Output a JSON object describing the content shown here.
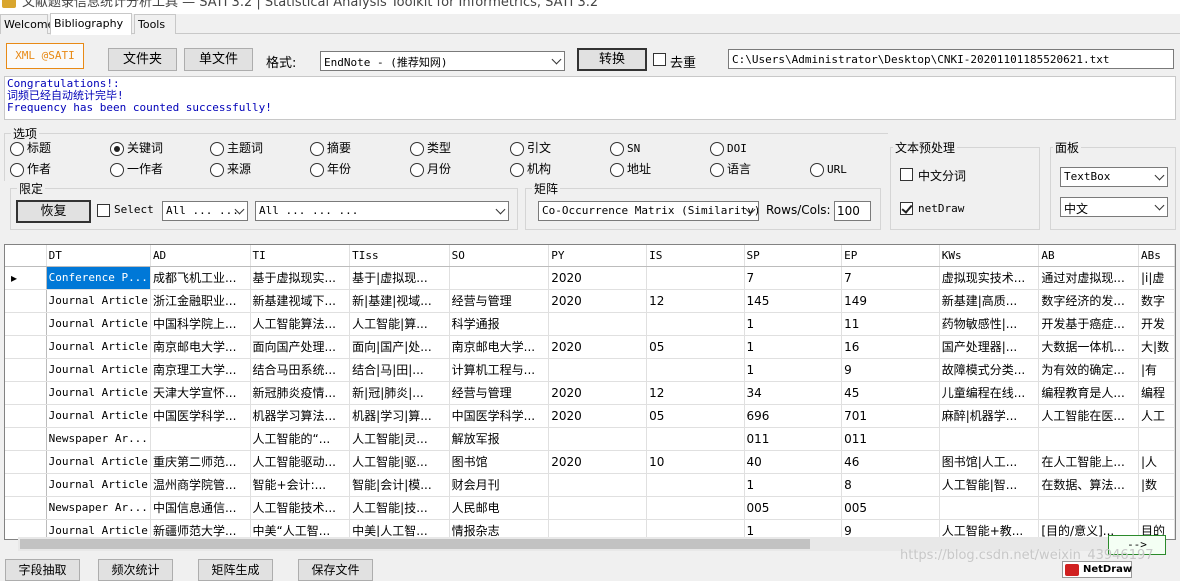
{
  "window": {
    "title": "文献题录信息统计分析工具 — SATI 3.2 | Statistical Analysis Toolkit for Informetrics, SATI 3.2"
  },
  "tabs": [
    "Welcome",
    "Bibliography",
    "Tools"
  ],
  "toolbar": {
    "xml_label": "XML @SATI",
    "folder_button": "文件夹",
    "file_button": "单文件",
    "format_label": "格式:",
    "format_value": "EndNote  - (推荐知网)",
    "convert_button": "转换",
    "dedupe_label": "去重",
    "path_value": "C:\\Users\\Administrator\\Desktop\\CNKI-20201101185520621.txt"
  },
  "messages": [
    "Congratulations!:",
    "词频已经自动统计完毕!",
    "Frequency has been counted successfully!"
  ],
  "options": {
    "title": "选项",
    "row1": [
      "标题",
      "关键词",
      "主题词",
      "摘要",
      "类型",
      "引文",
      "SN",
      "DOI"
    ],
    "row2": [
      "作者",
      "一作者",
      "来源",
      "年份",
      "月份",
      "机构",
      "地址",
      "语言",
      "URL"
    ],
    "selected": "关键词"
  },
  "limit": {
    "title": "限定",
    "restore_button": "恢复",
    "select_label": "Select",
    "combo1": "All ... ... ...",
    "combo2": "All ... ... ..."
  },
  "matrix": {
    "title": "矩阵",
    "type_value": "Co-Occurrence Matrix (Similarity)",
    "rowscols_label": "Rows/Cols:",
    "rowscols_value": "100"
  },
  "preprocess": {
    "title": "文本预处理",
    "segmentation_label": "中文分词",
    "netdraw_label": "netDraw"
  },
  "panel": {
    "title": "面板",
    "combo1": "TextBox",
    "combo2": "中文"
  },
  "grid": {
    "columns": [
      "DT",
      "AD",
      "TI",
      "TIss",
      "SO",
      "PY",
      "IS",
      "SP",
      "EP",
      "KWs",
      "AB",
      "ABs"
    ],
    "rows": [
      [
        "Conference P...",
        "成都飞机工业...",
        "基于虚拟现实...",
        "基于|虚拟现...",
        "",
        "2020",
        "",
        "7",
        "7",
        "虚拟现实技术...",
        "通过对虚拟现...",
        "|i|虚"
      ],
      [
        "Journal Article",
        "浙江金融职业...",
        "新基建视域下...",
        "新|基建|视域...",
        "经营与管理",
        "2020",
        "12",
        "145",
        "149",
        "新基建|高质...",
        "数字经济的发...",
        "数字"
      ],
      [
        "Journal Article",
        "中国科学院上...",
        "人工智能算法...",
        "人工智能|算...",
        "科学通报",
        "",
        "",
        "1",
        "11",
        "药物敏感性|...",
        "开发基于癌症...",
        "开发"
      ],
      [
        "Journal Article",
        "南京邮电大学...",
        "面向国产处理...",
        "面向|国产|处...",
        "南京邮电大学...",
        "2020",
        "05",
        "1",
        "16",
        "国产处理器|...",
        "大数据一体机...",
        "大|数"
      ],
      [
        "Journal Article",
        "南京理工大学...",
        "结合马田系统...",
        "结合|马|田|...",
        "计算机工程与...",
        "",
        "",
        "1",
        "9",
        "故障模式分类...",
        "为有效的确定...",
        "|有"
      ],
      [
        "Journal Article",
        "天津大学宣怀...",
        "新冠肺炎疫情...",
        "新|冠|肺炎|...",
        "经营与管理",
        "2020",
        "12",
        "34",
        "45",
        "儿童编程在线...",
        "编程教育是人...",
        "编程"
      ],
      [
        "Journal Article",
        "中国医学科学...",
        "机器学习算法...",
        "机器|学习|算...",
        "中国医学科学...",
        "2020",
        "05",
        "696",
        "701",
        "麻醉|机器学...",
        "人工智能在医...",
        "人工"
      ],
      [
        "Newspaper Ar...",
        "",
        "人工智能的“...",
        "人工智能|灵...",
        "解放军报",
        "",
        "",
        "011",
        "011",
        "",
        "",
        ""
      ],
      [
        "Journal Article",
        "重庆第二师范...",
        "人工智能驱动...",
        "人工智能|驱...",
        "图书馆",
        "2020",
        "10",
        "40",
        "46",
        "图书馆|人工...",
        "在人工智能上...",
        "|人"
      ],
      [
        "Journal Article",
        "温州商学院管...",
        "智能+会计:...",
        "智能|会计|模...",
        "财会月刊",
        "",
        "",
        "1",
        "8",
        "人工智能|智...",
        "在数据、算法...",
        "|数"
      ],
      [
        "Newspaper Ar...",
        "中国信息通信...",
        "人工智能技术...",
        "人工智能|技...",
        "人民邮电",
        "",
        "",
        "005",
        "005",
        "",
        "",
        ""
      ],
      [
        "Journal Article",
        "新疆师范大学...",
        "中美“人工智...",
        "中美|人工智...",
        "情报杂志",
        "",
        "",
        "1",
        "9",
        "人工智能+教...",
        "[目的/意义]...",
        "目的"
      ]
    ]
  },
  "bottom": {
    "buttons": [
      "字段抽取",
      "频次统计",
      "矩阵生成",
      "保存文件"
    ],
    "next_arrow": "-->",
    "netdraw_label": "NetDraw"
  },
  "watermark": "https://blog.csdn.net/weixin_43946197"
}
